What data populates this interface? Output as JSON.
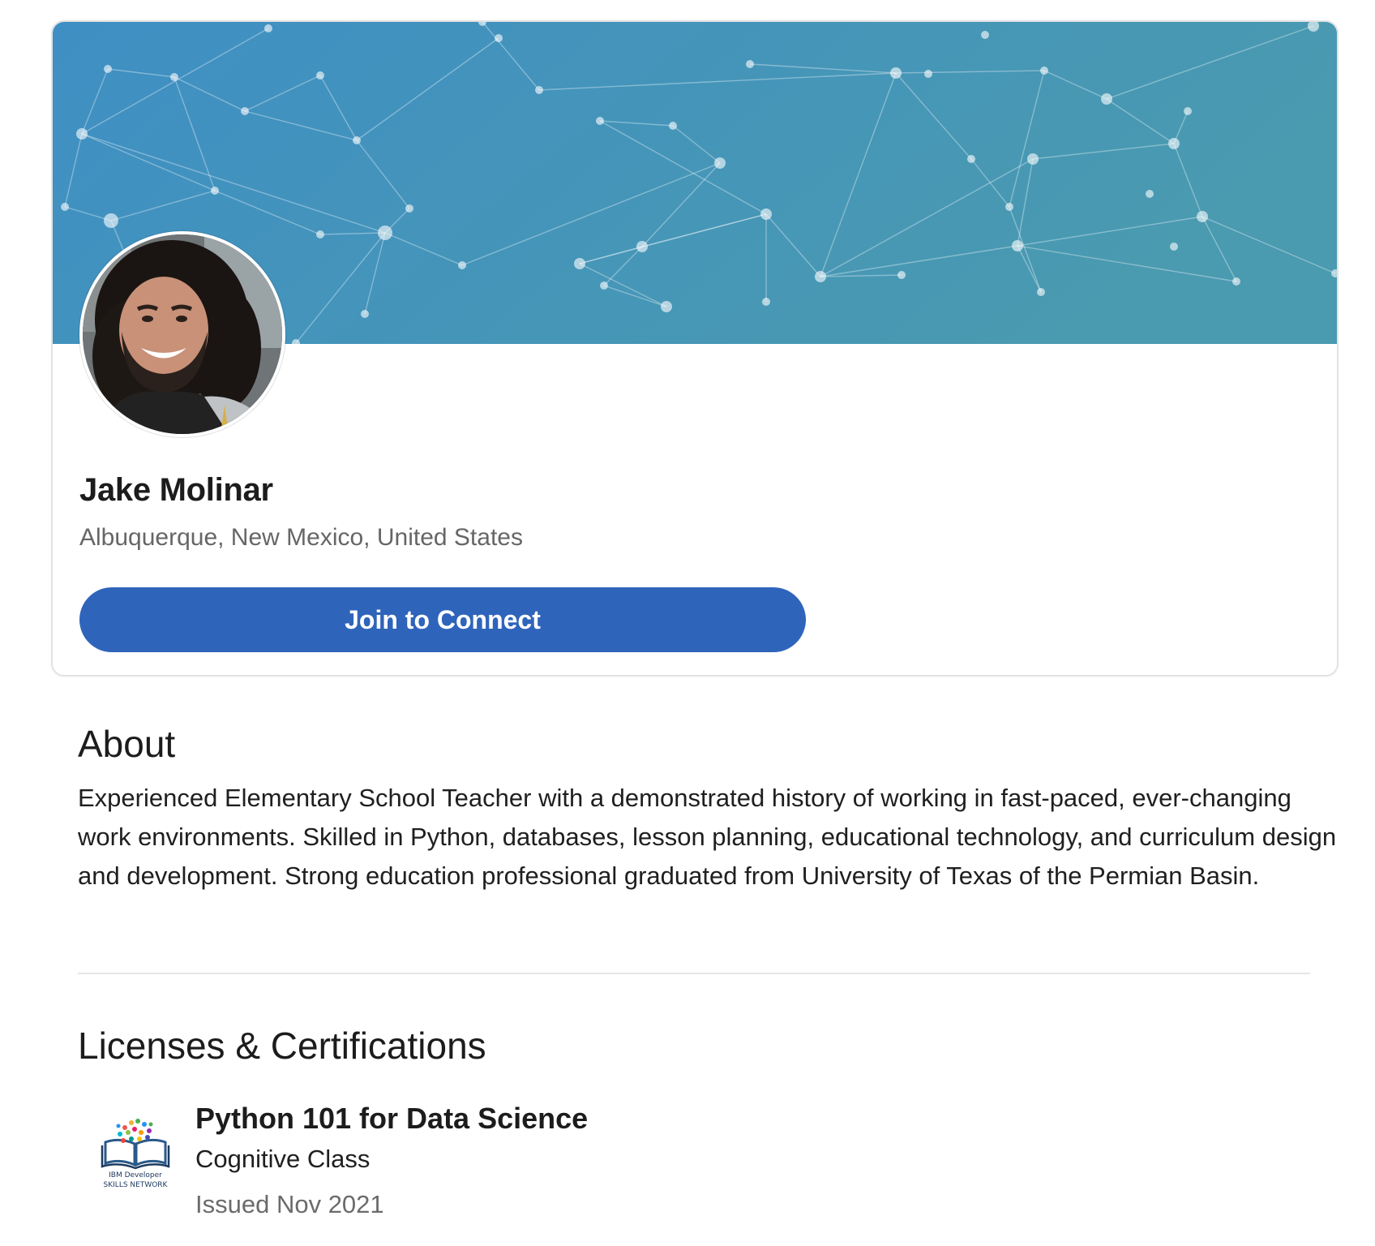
{
  "profile": {
    "name": "Jake Molinar",
    "location": "Albuquerque, New Mexico, United States",
    "connect_label": "Join to Connect",
    "banner_colors": [
      "#3f8fc4",
      "#4a9ab0"
    ],
    "button_color": "#2f64bb"
  },
  "about": {
    "title": "About",
    "text": "Experienced Elementary School Teacher with a demonstrated history of working in fast-paced, ever-changing work environments. Skilled in Python, databases, lesson planning, educational technology, and curriculum design and development. Strong education professional graduated from University of Texas of the Permian Basin."
  },
  "licenses": {
    "title": "Licenses & Certifications",
    "items": [
      {
        "name": "Python 101 for Data Science",
        "issuer": "Cognitive Class",
        "issued": "Issued Nov 2021",
        "logo_text": "IBM Developer\nSKILLS NETWORK"
      }
    ]
  }
}
